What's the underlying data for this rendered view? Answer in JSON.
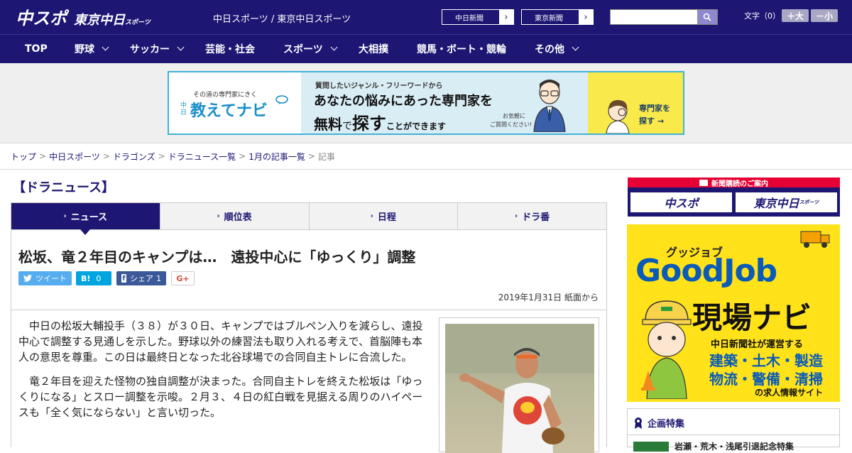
{
  "header": {
    "logo_main": "中スポ",
    "logo_sub": "東京中日",
    "logo_sub_small": "スポーツ",
    "site_name": "中日スポーツ / 東京中日スポーツ",
    "ext_links": [
      "中日新聞",
      "東京新聞"
    ],
    "font_size_label": "文字（0）",
    "font_larger": "＋大",
    "font_smaller": "－小"
  },
  "nav": {
    "items": [
      {
        "label": "TOP"
      },
      {
        "label": "野球"
      },
      {
        "label": "サッカー"
      },
      {
        "label": "芸能・社会"
      },
      {
        "label": "スポーツ"
      },
      {
        "label": "大相撲"
      },
      {
        "label": "競馬・ボート・競輪"
      },
      {
        "label": "その他"
      }
    ]
  },
  "ad_banner": {
    "tagline": "その道の専門家にきく",
    "brand": "教えてナビ",
    "brand_prefix": "中日",
    "line1": "質問したいジャンル・フリーワードから",
    "line2": "あなたの悩みにあった専門家を",
    "line3_a": "無料",
    "line3_b": "で",
    "line3_c": "探す",
    "line3_d": "ことができます",
    "aside": "お気軽に",
    "aside2": "ご質問ください!",
    "cta_1": "専門家を",
    "cta_2": "探す"
  },
  "breadcrumb": {
    "items": [
      "トップ",
      "中日スポーツ",
      "ドラゴンズ",
      "ドラニュース一覧",
      "1月の記事一覧"
    ],
    "current": "記事"
  },
  "section_title": "【ドラニュース】",
  "tabs": [
    {
      "label": "ニュース"
    },
    {
      "label": "順位表"
    },
    {
      "label": "日程"
    },
    {
      "label": "ドラ番"
    }
  ],
  "article": {
    "headline": "松坂、竜２年目のキャンプは…　遠投中心に「ゆっくり」調整",
    "social": {
      "tweet": "ツイート",
      "hatena": "B!",
      "hatena_count": "0",
      "share": "シェア",
      "share_count": "1",
      "gplus": "G+"
    },
    "date": "2019年1月31日 紙面から",
    "paragraphs": [
      "中日の松坂大輔投手（３８）が３０日、キャンプではブルペン入りを減らし、遠投中心で調整する見通しを示した。野球以外の練習法も取り入れる考えで、首脳陣も本人の意思を尊重。この日は最終日となった北谷球場での合同自主トレに合流した。",
      "竜２年目を迎えた怪物の独自調整が決まった。合同自主トレを終えた松坂は「ゆっくりになる」とスロー調整を示唆。２月３、４日の紅白戦を見据える周りのハイペースも「全く気にならない」と言い切った。"
    ]
  },
  "sidebar": {
    "subscribe_head": "新聞購読のご案内",
    "subscribe_btn1": "中スポ",
    "subscribe_btn2": "東京中日",
    "subscribe_btn2_small": "スポーツ",
    "goodjob_kana": "グッジョブ",
    "goodjob_title": "GoodJob",
    "goodjob_sub": "現場ナビ",
    "goodjob_line1": "中日新聞社が運営する",
    "goodjob_line2": "建築・土木・製造",
    "goodjob_line3": "物流・警備・清掃",
    "goodjob_line4": "の求人情報サイト",
    "feature_title": "企画特集",
    "feature_item": "岩瀬・荒木・浅尾引退記念特集"
  },
  "colors": {
    "brand_navy": "#1d1773",
    "twitter": "#55acee",
    "hatena": "#00a4de",
    "facebook": "#3b5998",
    "gplus_red": "#dd4b39",
    "subscribe_red": "#e60033",
    "goodjob_yellow": "#ffe21a",
    "goodjob_blue": "#0a5bb7"
  }
}
